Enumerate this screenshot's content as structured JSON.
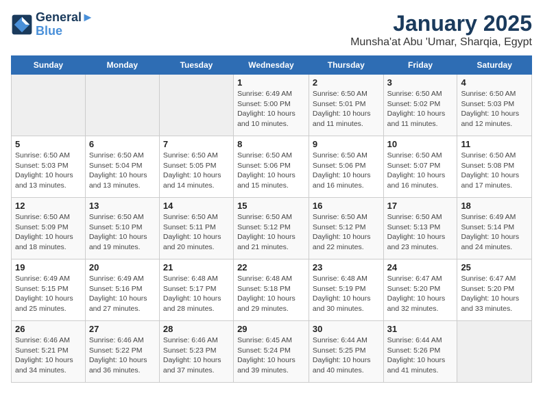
{
  "header": {
    "logo_line1": "General",
    "logo_line2": "Blue",
    "month": "January 2025",
    "location": "Munsha'at Abu 'Umar, Sharqia, Egypt"
  },
  "weekdays": [
    "Sunday",
    "Monday",
    "Tuesday",
    "Wednesday",
    "Thursday",
    "Friday",
    "Saturday"
  ],
  "weeks": [
    [
      {
        "day": "",
        "info": ""
      },
      {
        "day": "",
        "info": ""
      },
      {
        "day": "",
        "info": ""
      },
      {
        "day": "1",
        "info": "Sunrise: 6:49 AM\nSunset: 5:00 PM\nDaylight: 10 hours\nand 10 minutes."
      },
      {
        "day": "2",
        "info": "Sunrise: 6:50 AM\nSunset: 5:01 PM\nDaylight: 10 hours\nand 11 minutes."
      },
      {
        "day": "3",
        "info": "Sunrise: 6:50 AM\nSunset: 5:02 PM\nDaylight: 10 hours\nand 11 minutes."
      },
      {
        "day": "4",
        "info": "Sunrise: 6:50 AM\nSunset: 5:03 PM\nDaylight: 10 hours\nand 12 minutes."
      }
    ],
    [
      {
        "day": "5",
        "info": "Sunrise: 6:50 AM\nSunset: 5:03 PM\nDaylight: 10 hours\nand 13 minutes."
      },
      {
        "day": "6",
        "info": "Sunrise: 6:50 AM\nSunset: 5:04 PM\nDaylight: 10 hours\nand 13 minutes."
      },
      {
        "day": "7",
        "info": "Sunrise: 6:50 AM\nSunset: 5:05 PM\nDaylight: 10 hours\nand 14 minutes."
      },
      {
        "day": "8",
        "info": "Sunrise: 6:50 AM\nSunset: 5:06 PM\nDaylight: 10 hours\nand 15 minutes."
      },
      {
        "day": "9",
        "info": "Sunrise: 6:50 AM\nSunset: 5:06 PM\nDaylight: 10 hours\nand 16 minutes."
      },
      {
        "day": "10",
        "info": "Sunrise: 6:50 AM\nSunset: 5:07 PM\nDaylight: 10 hours\nand 16 minutes."
      },
      {
        "day": "11",
        "info": "Sunrise: 6:50 AM\nSunset: 5:08 PM\nDaylight: 10 hours\nand 17 minutes."
      }
    ],
    [
      {
        "day": "12",
        "info": "Sunrise: 6:50 AM\nSunset: 5:09 PM\nDaylight: 10 hours\nand 18 minutes."
      },
      {
        "day": "13",
        "info": "Sunrise: 6:50 AM\nSunset: 5:10 PM\nDaylight: 10 hours\nand 19 minutes."
      },
      {
        "day": "14",
        "info": "Sunrise: 6:50 AM\nSunset: 5:11 PM\nDaylight: 10 hours\nand 20 minutes."
      },
      {
        "day": "15",
        "info": "Sunrise: 6:50 AM\nSunset: 5:12 PM\nDaylight: 10 hours\nand 21 minutes."
      },
      {
        "day": "16",
        "info": "Sunrise: 6:50 AM\nSunset: 5:12 PM\nDaylight: 10 hours\nand 22 minutes."
      },
      {
        "day": "17",
        "info": "Sunrise: 6:50 AM\nSunset: 5:13 PM\nDaylight: 10 hours\nand 23 minutes."
      },
      {
        "day": "18",
        "info": "Sunrise: 6:49 AM\nSunset: 5:14 PM\nDaylight: 10 hours\nand 24 minutes."
      }
    ],
    [
      {
        "day": "19",
        "info": "Sunrise: 6:49 AM\nSunset: 5:15 PM\nDaylight: 10 hours\nand 25 minutes."
      },
      {
        "day": "20",
        "info": "Sunrise: 6:49 AM\nSunset: 5:16 PM\nDaylight: 10 hours\nand 27 minutes."
      },
      {
        "day": "21",
        "info": "Sunrise: 6:48 AM\nSunset: 5:17 PM\nDaylight: 10 hours\nand 28 minutes."
      },
      {
        "day": "22",
        "info": "Sunrise: 6:48 AM\nSunset: 5:18 PM\nDaylight: 10 hours\nand 29 minutes."
      },
      {
        "day": "23",
        "info": "Sunrise: 6:48 AM\nSunset: 5:19 PM\nDaylight: 10 hours\nand 30 minutes."
      },
      {
        "day": "24",
        "info": "Sunrise: 6:47 AM\nSunset: 5:20 PM\nDaylight: 10 hours\nand 32 minutes."
      },
      {
        "day": "25",
        "info": "Sunrise: 6:47 AM\nSunset: 5:20 PM\nDaylight: 10 hours\nand 33 minutes."
      }
    ],
    [
      {
        "day": "26",
        "info": "Sunrise: 6:46 AM\nSunset: 5:21 PM\nDaylight: 10 hours\nand 34 minutes."
      },
      {
        "day": "27",
        "info": "Sunrise: 6:46 AM\nSunset: 5:22 PM\nDaylight: 10 hours\nand 36 minutes."
      },
      {
        "day": "28",
        "info": "Sunrise: 6:46 AM\nSunset: 5:23 PM\nDaylight: 10 hours\nand 37 minutes."
      },
      {
        "day": "29",
        "info": "Sunrise: 6:45 AM\nSunset: 5:24 PM\nDaylight: 10 hours\nand 39 minutes."
      },
      {
        "day": "30",
        "info": "Sunrise: 6:44 AM\nSunset: 5:25 PM\nDaylight: 10 hours\nand 40 minutes."
      },
      {
        "day": "31",
        "info": "Sunrise: 6:44 AM\nSunset: 5:26 PM\nDaylight: 10 hours\nand 41 minutes."
      },
      {
        "day": "",
        "info": ""
      }
    ]
  ]
}
